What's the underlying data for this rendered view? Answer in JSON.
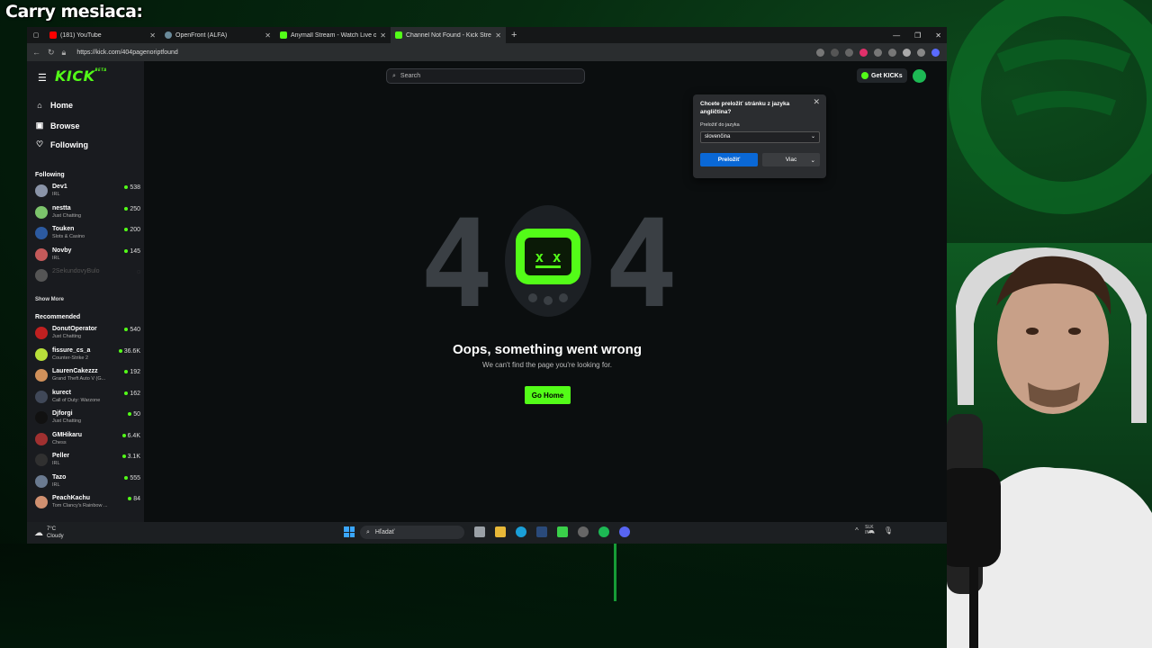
{
  "overlay": {
    "title": "Carry mesiaca:"
  },
  "browser": {
    "tabs": [
      {
        "label": "(181) YouTube",
        "icon": "youtube-icon",
        "color": "#ff0000"
      },
      {
        "label": "OpenFront (ALFA)",
        "icon": "openfront-icon",
        "color": "#6a8a9a"
      },
      {
        "label": "Anymall Stream - Watch Live on K",
        "icon": "kick-icon",
        "color": "#53fc18"
      },
      {
        "label": "Channel Not Found - Kick Stream",
        "icon": "kick-icon",
        "color": "#53fc18"
      }
    ],
    "url": "https://kick.com/404pagenoriptfound"
  },
  "kick": {
    "logo": "KICK",
    "beta": "BETA",
    "nav": [
      {
        "label": "Home",
        "icon": "home-icon",
        "glyph": "⌂"
      },
      {
        "label": "Browse",
        "icon": "browse-icon",
        "glyph": "▣"
      },
      {
        "label": "Following",
        "icon": "heart-icon",
        "glyph": "♡"
      }
    ],
    "following_header": "Following",
    "following": [
      {
        "name": "Dev1",
        "category": "IRL",
        "viewers": "538",
        "avatar_color": "#8a94a8"
      },
      {
        "name": "nestta",
        "category": "Just Chatting",
        "viewers": "250",
        "avatar_color": "#7cc46b"
      },
      {
        "name": "Touken",
        "category": "Slots & Casino",
        "viewers": "200",
        "avatar_color": "#2c5aa0"
      },
      {
        "name": "Novby",
        "category": "IRL",
        "viewers": "145",
        "avatar_color": "#c45a5a"
      },
      {
        "name": "2SekundovyBulo",
        "category": "",
        "viewers": "",
        "avatar_color": "#555555",
        "offline": true
      }
    ],
    "show_more": "Show More",
    "recommended_header": "Recommended",
    "recommended": [
      {
        "name": "DonutOperator",
        "category": "Just Chatting",
        "viewers": "540",
        "avatar_color": "#c02020"
      },
      {
        "name": "fissure_cs_a",
        "category": "Counter-Strike 2",
        "viewers": "36.6K",
        "avatar_color": "#b8e03a"
      },
      {
        "name": "LaurenCakezzz",
        "category": "Grand Theft Auto V (G...",
        "viewers": "192",
        "avatar_color": "#d0905a"
      },
      {
        "name": "kurect",
        "category": "Call of Duty: Warzone",
        "viewers": "162",
        "avatar_color": "#404858"
      },
      {
        "name": "Djforgi",
        "category": "Just Chatting",
        "viewers": "50",
        "avatar_color": "#111111"
      },
      {
        "name": "GMHikaru",
        "category": "Chess",
        "viewers": "6.4K",
        "avatar_color": "#a03030"
      },
      {
        "name": "Peller",
        "category": "IRL",
        "viewers": "3.1K",
        "avatar_color": "#303030"
      },
      {
        "name": "Tazo",
        "category": "IRL",
        "viewers": "555",
        "avatar_color": "#6a7a90"
      },
      {
        "name": "PeachKachu",
        "category": "Tom Clancy's Rainbow ...",
        "viewers": "84",
        "avatar_color": "#d09070"
      }
    ],
    "search_placeholder": "Search",
    "get_kicks": "Get KICKs",
    "error": {
      "code_left": "4",
      "code_right": "4",
      "title": "Oops, something went wrong",
      "subtitle": "We can't find the page you're looking for.",
      "button": "Go Home"
    }
  },
  "translate_popup": {
    "question": "Chcete preložiť stránku z jazyka angličtina?",
    "label": "Preložiť do jazyka",
    "selected_language": "slovenčina",
    "translate_button": "Preložiť",
    "more_button": "Viac"
  },
  "taskbar": {
    "temperature": "7°C",
    "weather": "Cloudy",
    "search_placeholder": "Hľadať",
    "lang_line1": "SLK",
    "lang_line2": "INTL"
  },
  "colors": {
    "kick_green": "#53fc18",
    "translate_blue": "#0a68d6"
  }
}
